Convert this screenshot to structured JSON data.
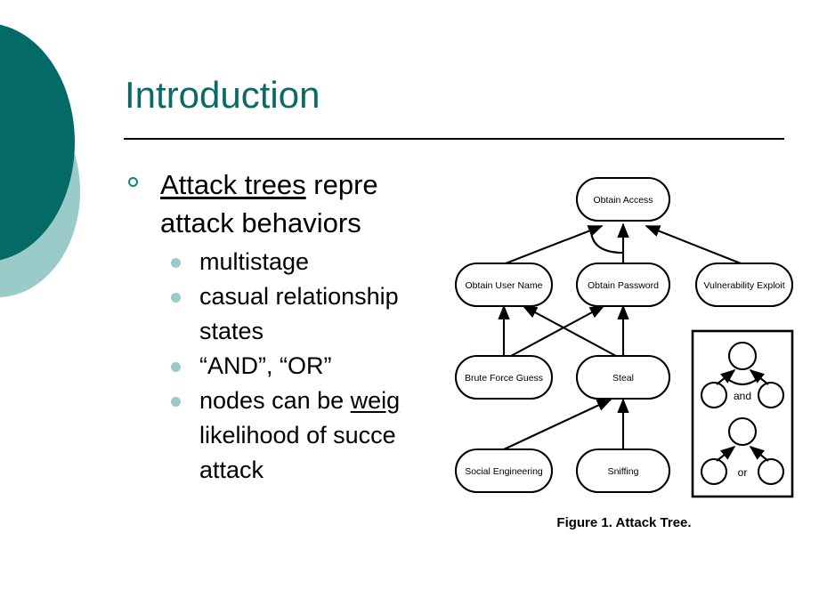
{
  "slide": {
    "title": "Introduction",
    "theme": {
      "title_color": "#0A6A68",
      "accent_dark": "#046A68",
      "accent_light": "#9ACBC8",
      "bullet_l1_color": "#128283",
      "bullet_l2_color": "#9ACBC8",
      "body_color": "#000000"
    }
  },
  "bullets": {
    "level1": {
      "lead_underlined": "Attack trees",
      "rest": " repre",
      "line2": "attack behaviors"
    },
    "level2": [
      {
        "text": "multistage"
      },
      {
        "text": "casual relationship",
        "line2": "states"
      },
      {
        "text": "“AND”, “OR”"
      },
      {
        "pre": "nodes can be ",
        "underlined": "weig",
        "line2": "likelihood of succe",
        "line3": "attack"
      }
    ]
  },
  "figure": {
    "caption": "Figure 1. Attack Tree.",
    "nodes": [
      {
        "id": "obtain-access",
        "label": "Obtain Access"
      },
      {
        "id": "obtain-user-name",
        "label": "Obtain User Name"
      },
      {
        "id": "obtain-password",
        "label": "Obtain Password"
      },
      {
        "id": "vulnerability-exploit",
        "label": "Vulnerability Exploit"
      },
      {
        "id": "brute-force-guess",
        "label": "Brute Force Guess"
      },
      {
        "id": "steal",
        "label": "Steal"
      },
      {
        "id": "social-engineering",
        "label": "Social Engineering"
      },
      {
        "id": "sniffing",
        "label": "Sniffing"
      }
    ],
    "legend": {
      "and_label": "and",
      "or_label": "or"
    }
  }
}
